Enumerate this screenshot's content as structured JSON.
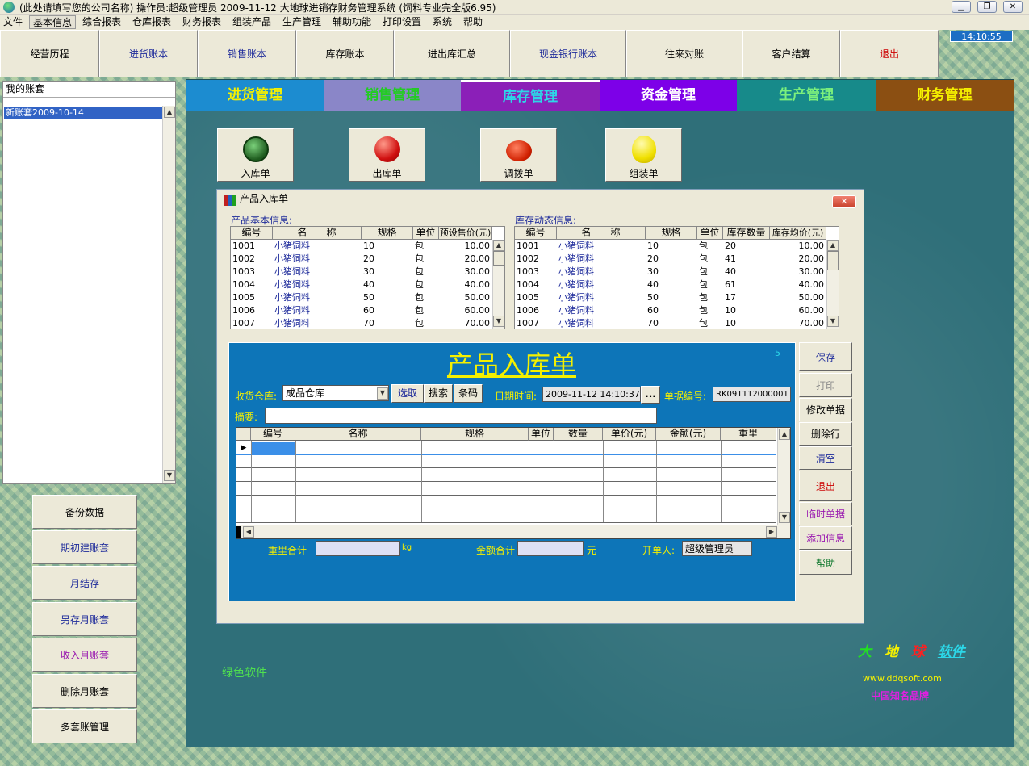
{
  "window": {
    "title": "(此处请填写您的公司名称)    操作员:超级管理员    2009-11-12  大地球进销存财务管理系统  (饲料专业完全版6.95)",
    "controls": [
      "▁",
      "❐",
      "✕"
    ]
  },
  "menu": [
    "文件",
    "基本信息",
    "综合报表",
    "仓库报表",
    "财务报表",
    "组装产品",
    "生产管理",
    "辅助功能",
    "打印设置",
    "系统",
    "帮助"
  ],
  "toolbar": [
    "经营历程",
    "进货账本",
    "销售账本",
    "库存账本",
    "进出库汇总",
    "现金银行账本",
    "往来对账",
    "客户结算",
    "退出"
  ],
  "clock": "14:10:55",
  "accounts": {
    "title": "我的账套",
    "selected": "新账套2009-10-14"
  },
  "side_buttons": [
    "备份数据",
    "期初建账套",
    "月结存",
    "另存月账套",
    "收入月账套",
    "删除月账套",
    "多套账管理"
  ],
  "main_tabs": [
    {
      "label": "进货管理",
      "bg": "#1c8cd0",
      "fg": "#f5f000"
    },
    {
      "label": "销售管理",
      "bg": "#8a86c8",
      "fg": "#22cc22"
    },
    {
      "label": "库存管理",
      "bg": "#8b1fb8",
      "fg": "#2cd7e8"
    },
    {
      "label": "资金管理",
      "bg": "#7d00e8",
      "fg": "#ffffff"
    },
    {
      "label": "生产管理",
      "bg": "#178a8a",
      "fg": "#7cf07c"
    },
    {
      "label": "财务管理",
      "bg": "#8b4f12",
      "fg": "#f5f000"
    }
  ],
  "doc_buttons": [
    {
      "label": "入库单",
      "icon": "watermelon-icon"
    },
    {
      "label": "出库单",
      "icon": "red-apple-icon"
    },
    {
      "label": "调拨单",
      "icon": "tomato-icon"
    },
    {
      "label": "组装单",
      "icon": "lemon-icon"
    }
  ],
  "dialog": {
    "title": "产品入库单",
    "close": "✕",
    "product_info": {
      "label": "产品基本信息:",
      "columns": [
        "编号",
        "名　　称",
        "规格",
        "单位",
        "预设售价(元)"
      ],
      "rows": [
        [
          "1001",
          "小猪饲料",
          "10",
          "包",
          "10.00"
        ],
        [
          "1002",
          "小猪饲料",
          "20",
          "包",
          "20.00"
        ],
        [
          "1003",
          "小猪饲料",
          "30",
          "包",
          "30.00"
        ],
        [
          "1004",
          "小猪饲料",
          "40",
          "包",
          "40.00"
        ],
        [
          "1005",
          "小猪饲料",
          "50",
          "包",
          "50.00"
        ],
        [
          "1006",
          "小猪饲料",
          "60",
          "包",
          "60.00"
        ],
        [
          "1007",
          "小猪饲料",
          "70",
          "包",
          "70.00"
        ]
      ]
    },
    "stock_info": {
      "label": "库存动态信息:",
      "columns": [
        "编号",
        "名　　称",
        "规格",
        "单位",
        "库存数量",
        "库存均价(元)"
      ],
      "rows": [
        [
          "1001",
          "小猪饲料",
          "10",
          "包",
          "20",
          "10.00"
        ],
        [
          "1002",
          "小猪饲料",
          "20",
          "包",
          "41",
          "20.00"
        ],
        [
          "1003",
          "小猪饲料",
          "30",
          "包",
          "40",
          "30.00"
        ],
        [
          "1004",
          "小猪饲料",
          "40",
          "包",
          "61",
          "40.00"
        ],
        [
          "1005",
          "小猪饲料",
          "50",
          "包",
          "17",
          "50.00"
        ],
        [
          "1006",
          "小猪饲料",
          "60",
          "包",
          "10",
          "60.00"
        ],
        [
          "1007",
          "小猪饲料",
          "70",
          "包",
          "10",
          "70.00"
        ]
      ]
    },
    "form": {
      "title": "产品入库单",
      "record_count": "5",
      "warehouse_label": "收货仓库:",
      "warehouse_value": "成品仓库",
      "select_btn": "选取",
      "search_btn": "搜索",
      "barcode_btn": "条码",
      "datetime_label": "日期时间:",
      "datetime_value": "2009-11-12  14:10:37",
      "datetime_btn": "...",
      "docno_label": "单据编号:",
      "docno_value": "RK091112000001",
      "memo_label": "摘要:",
      "memo_value": "",
      "table_columns": [
        "编号",
        "名称",
        "规格",
        "单位",
        "数量",
        "单价(元)",
        "金额(元)",
        "重里"
      ],
      "weight_total_label": "重里合计",
      "weight_unit": "kg",
      "amount_total_label": "金额合计",
      "amount_unit": "元",
      "operator_label": "开单人:",
      "operator_value": "超级管理员"
    },
    "right_buttons": [
      {
        "label": "保存",
        "style": "blue"
      },
      {
        "label": "打印",
        "style": "gray"
      },
      {
        "label": "修改单据",
        "style": "black"
      },
      {
        "label": "删除行",
        "style": "black"
      },
      {
        "label": "清空",
        "style": "blue"
      },
      {
        "label": "退出",
        "style": "red"
      },
      {
        "label": "临时单据",
        "style": "purple"
      },
      {
        "label": "添加信息",
        "style": "purple"
      },
      {
        "label": "帮助",
        "style": "green"
      }
    ]
  },
  "footer": {
    "green_software": "绿色软件",
    "brand": [
      "大",
      "地",
      "球",
      "软件"
    ],
    "website": "www.ddqsoft.com",
    "trademark": "中国知名品牌"
  }
}
